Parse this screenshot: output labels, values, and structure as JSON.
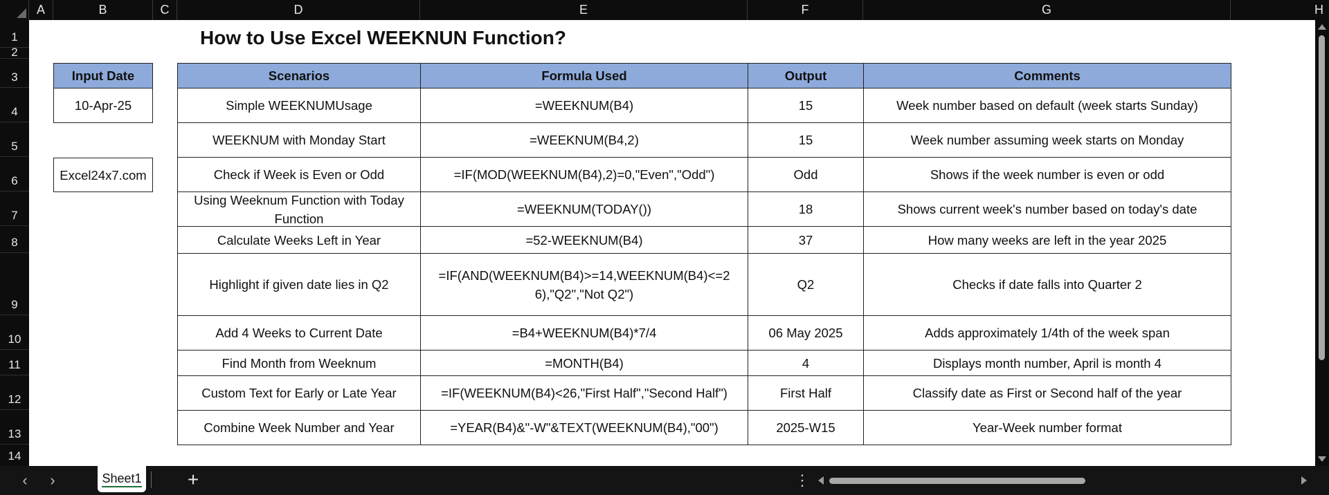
{
  "column_headers": [
    "A",
    "B",
    "C",
    "D",
    "E",
    "F",
    "G",
    "H"
  ],
  "row_headers": [
    "1",
    "2",
    "3",
    "4",
    "5",
    "6",
    "7",
    "8",
    "9",
    "10",
    "11",
    "12",
    "13",
    "14"
  ],
  "title": "How to Use Excel WEEKNUN Function?",
  "input": {
    "header": "Input Date",
    "date": "10-Apr-25",
    "brand": "Excel24x7.com"
  },
  "table": {
    "headers": [
      "Scenarios",
      "Formula Used",
      "Output",
      "Comments"
    ],
    "rows": [
      [
        "Simple WEEKNUMUsage",
        "=WEEKNUM(B4)",
        "15",
        "Week number based on default (week starts Sunday)"
      ],
      [
        "WEEKNUM with Monday Start",
        "=WEEKNUM(B4,2)",
        "15",
        "Week number assuming week starts on Monday"
      ],
      [
        "Check if Week is Even or Odd",
        "=IF(MOD(WEEKNUM(B4),2)=0,\"Even\",\"Odd\")",
        "Odd",
        "Shows if the week number is even or odd"
      ],
      [
        "Using Weeknum Function with Today Function",
        "=WEEKNUM(TODAY())",
        "18",
        "Shows current week's number based on today's date"
      ],
      [
        "Calculate Weeks Left in Year",
        "=52-WEEKNUM(B4)",
        "37",
        "How many weeks are left in the year 2025"
      ],
      [
        "Highlight if given date lies in Q2",
        "=IF(AND(WEEKNUM(B4)>=14,WEEKNUM(B4)<=26),\"Q2\",\"Not Q2\")",
        "Q2",
        "Checks if date falls into Quarter 2"
      ],
      [
        "Add 4 Weeks to Current Date",
        "=B4+WEEKNUM(B4)*7/4",
        "06 May 2025",
        "Adds approximately 1/4th of the week span"
      ],
      [
        "Find Month from Weeknum",
        "=MONTH(B4)",
        "4",
        "Displays month number, April is month 4"
      ],
      [
        "Custom Text for Early or Late Year",
        "=IF(WEEKNUM(B4)<26,\"First Half\",\"Second Half\")",
        "First Half",
        "Classify date as First or Second half of the year"
      ],
      [
        "Combine Week Number and Year",
        "=YEAR(B4)&\"-W\"&TEXT(WEEKNUM(B4),\"00\")",
        "2025-W15",
        "Year-Week number format"
      ]
    ]
  },
  "tabs": {
    "sheet": "Sheet1",
    "add_label": "+",
    "more_label": "⋮",
    "prev_label": "‹",
    "next_label": "›"
  },
  "colors": {
    "header_fill": "#8eaadb",
    "chrome": "#0b0b0b",
    "tab_underline": "#1e6f3b"
  },
  "icons": [
    "select-all-icon",
    "prev-sheet-icon",
    "next-sheet-icon",
    "add-sheet-icon",
    "more-options-icon"
  ]
}
